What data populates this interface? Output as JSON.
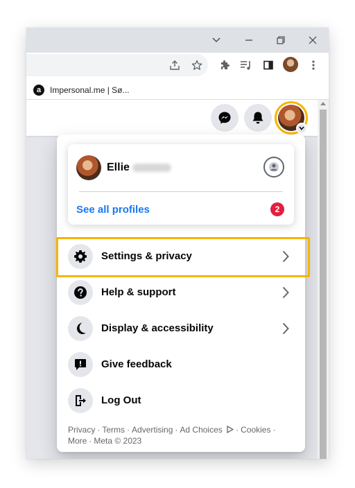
{
  "browser": {
    "bookmarks": [
      {
        "label": "Impersonal.me | Sø..."
      }
    ]
  },
  "facebook": {
    "profile": {
      "name": "Ellie",
      "see_all_label": "See all profiles",
      "badge_count": "2"
    },
    "menu_items": [
      {
        "label": "Settings & privacy",
        "icon": "gear-icon",
        "has_chevron": true,
        "highlighted": true
      },
      {
        "label": "Help & support",
        "icon": "question-icon",
        "has_chevron": true
      },
      {
        "label": "Display & accessibility",
        "icon": "moon-icon",
        "has_chevron": true
      },
      {
        "label": "Give feedback",
        "icon": "feedback-icon",
        "has_chevron": false
      },
      {
        "label": "Log Out",
        "icon": "logout-icon",
        "has_chevron": false
      }
    ],
    "footer": {
      "privacy": "Privacy",
      "terms": "Terms",
      "advertising": "Advertising",
      "ad_choices": "Ad Choices",
      "cookies": "Cookies",
      "more": "More",
      "copyright": "Meta © 2023"
    }
  },
  "colors": {
    "highlight": "#f7b500",
    "link": "#1877f2",
    "badge": "#e41e3f"
  }
}
